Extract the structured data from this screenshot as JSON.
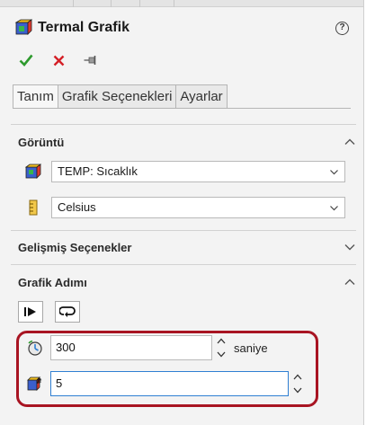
{
  "header": {
    "title": "Termal Grafik",
    "help_label": "?"
  },
  "actions": {
    "ok": "ok",
    "cancel": "cancel",
    "pin": "pin"
  },
  "tabs": [
    {
      "label": "Tanım",
      "active": true
    },
    {
      "label": "Grafik Seçenekleri",
      "active": false
    },
    {
      "label": "Ayarlar",
      "active": false
    }
  ],
  "display": {
    "title": "Görüntü",
    "expanded": true,
    "result_select": "TEMP: Sıcaklık",
    "unit_select": "Celsius"
  },
  "advanced": {
    "title": "Gelişmiş Seçenekler",
    "expanded": false
  },
  "chart_step": {
    "title": "Grafik Adımı",
    "expanded": true,
    "time_value": "300",
    "time_unit": "saniye",
    "step_value": "5"
  },
  "colors": {
    "accent_green": "#2e9a2e",
    "accent_red": "#d41f26",
    "highlight_border": "#a81422",
    "focus_blue": "#2f7fd2"
  },
  "icons": {
    "title": "thermal-plot-icon",
    "ok": "check-icon",
    "cancel": "close-icon",
    "pin": "pushpin-icon",
    "result": "temperature-plot-icon",
    "unit": "ruler-icon",
    "play": "play-step-icon",
    "loop": "loop-icon",
    "time": "timer-icon",
    "step": "step-count-icon"
  }
}
